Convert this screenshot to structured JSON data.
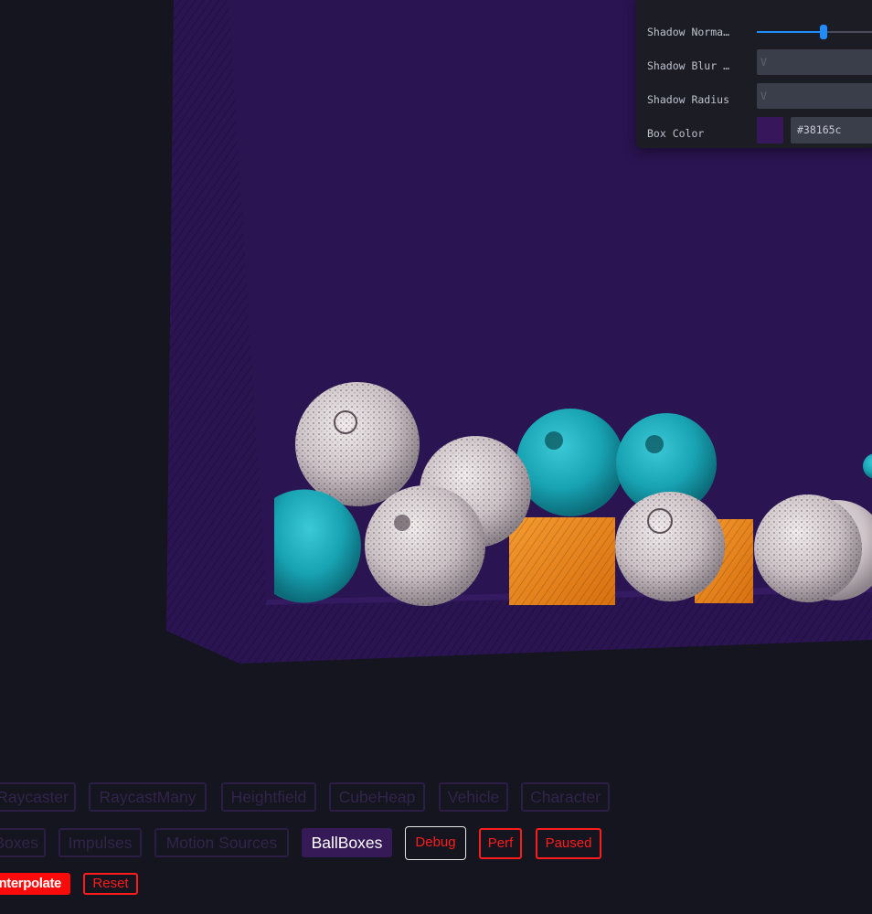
{
  "panel": {
    "rows": [
      {
        "label": "Shadow Norma…",
        "type": "slider",
        "value_fraction": 0.52
      },
      {
        "label": "Shadow Blur …",
        "type": "text",
        "value": "V"
      },
      {
        "label": "Shadow Radius",
        "type": "text",
        "value": "V"
      },
      {
        "label": "Box Color",
        "type": "color",
        "value": "#38165c"
      }
    ]
  },
  "demos": {
    "row1": [
      "Raycaster",
      "RaycastMany",
      "Heightfield",
      "CubeHeap",
      "Vehicle",
      "Character"
    ],
    "row2": [
      "Boxes",
      "Impulses",
      "Motion Sources",
      "BallBoxes"
    ],
    "active": "BallBoxes"
  },
  "toggles": {
    "debug": "Debug",
    "perf": "Perf",
    "paused": "Paused",
    "interpolate": "Interpolate",
    "reset": "Reset"
  },
  "colors": {
    "background": "#14151e",
    "container": "#2a1451",
    "ball_white": "#d8cfd2",
    "ball_teal": "#1ba9b8",
    "box_orange": "#f08a1e",
    "accent_red": "#ff1c1c",
    "slider_blue": "#1f8cff"
  }
}
